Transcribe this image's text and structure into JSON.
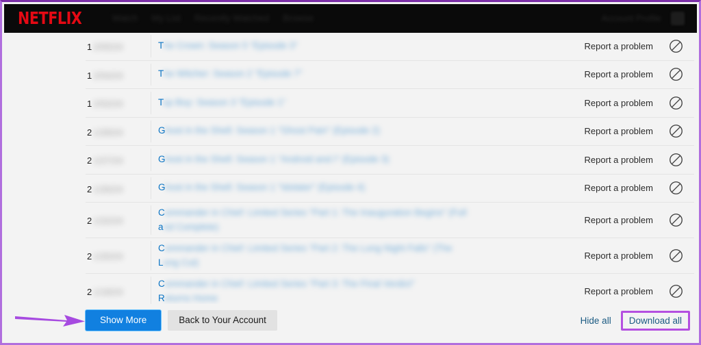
{
  "header": {
    "logo_text": "NETFLIX",
    "nav_items": [
      {
        "label": "Watch"
      },
      {
        "label": "My List"
      },
      {
        "label": "Recently Watched"
      },
      {
        "label": "Browse"
      }
    ],
    "account_label": "Account Profile",
    "avatar_name": "profile-avatar"
  },
  "table": {
    "report_label": "Report a problem",
    "action_icon": "no-entry-icon",
    "rows": [
      {
        "date_prefix": "1",
        "date_blur": "2/05/24",
        "title_prefix": "T",
        "title_blur": "he Crown: Season 5 \"Episode 3\"",
        "second_prefix": "",
        "second_blur": "",
        "tall": false
      },
      {
        "date_prefix": "1",
        "date_blur": "2/04/24",
        "title_prefix": "T",
        "title_blur": "he Witcher: Season 2 \"Episode 7\"",
        "second_prefix": "",
        "second_blur": "",
        "tall": false
      },
      {
        "date_prefix": "1",
        "date_blur": "2/02/24",
        "title_prefix": "T",
        "title_blur": "op Boy: Season 3 \"Episode 1\"",
        "second_prefix": "",
        "second_blur": "",
        "tall": false
      },
      {
        "date_prefix": "2",
        "date_blur": "1/28/24",
        "title_prefix": "G",
        "title_blur": "host in the Shell: Season 1 \"Ghost Pain\" (Episode 2)",
        "second_prefix": "",
        "second_blur": "",
        "tall": false
      },
      {
        "date_prefix": "2",
        "date_blur": "1/27/24",
        "title_prefix": "G",
        "title_blur": "host in the Shell: Season 1 \"Android and I\" (Episode 3)",
        "second_prefix": "",
        "second_blur": "",
        "tall": false
      },
      {
        "date_prefix": "2",
        "date_blur": "1/26/24",
        "title_prefix": "G",
        "title_blur": "host in the Shell: Season 1 \"Idolater\" (Episode 4)",
        "second_prefix": "",
        "second_blur": "",
        "tall": false
      },
      {
        "date_prefix": "2",
        "date_blur": "1/22/24",
        "title_prefix": "C",
        "title_blur": "ommander in Chief: Limited Series \"Part 1: The Inauguration Begins\" (Full",
        "second_prefix": "a",
        "second_blur": "nd Complete)",
        "tall": true
      },
      {
        "date_prefix": "2",
        "date_blur": "1/20/24",
        "title_prefix": "C",
        "title_blur": "ommander in Chief: Limited Series \"Part 2: The Long Night Falls\" (The",
        "second_prefix": "L",
        "second_blur": "ong Cut)",
        "tall": true
      },
      {
        "date_prefix": "2",
        "date_blur": "1/18/24",
        "title_prefix": "C",
        "title_blur": "ommander in Chief: Limited Series \"Part 3: The Final Verdict\"",
        "second_prefix": "R",
        "second_blur": "eturns Home",
        "tall": true
      }
    ]
  },
  "footer": {
    "show_more_label": "Show More",
    "back_account_label": "Back to Your Account",
    "hide_all_label": "Hide all",
    "download_all_label": "Download all"
  },
  "colors": {
    "netflix_red": "#e50914",
    "primary_blue": "#1180e0",
    "link_blue": "#0b74c4",
    "annotation_purple": "#b44fe0",
    "frame_purple_top": "#7b2fa8",
    "frame_purple": "#b06ede",
    "page_background": "#f3f3f3",
    "header_black": "#0a0a0a"
  }
}
